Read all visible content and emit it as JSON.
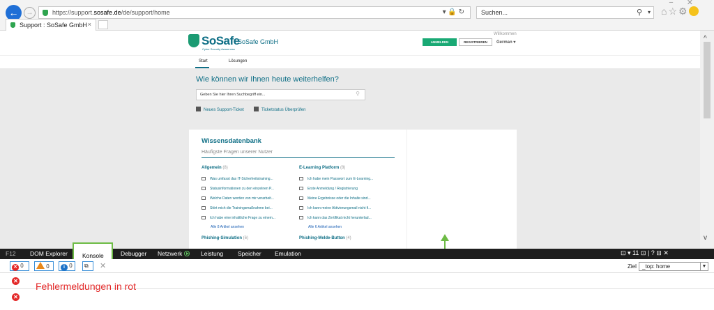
{
  "browser": {
    "url_prefix": "https://support.",
    "url_domain": "sosafe.de",
    "url_path": "/de/support/home",
    "search_placeholder": "Suchen...",
    "tab_title": "Support : SoSafe GmbH",
    "tab_close": "×"
  },
  "site": {
    "logo": "SoSafe",
    "logo_sub": "Cyber Security Awareness",
    "company": "SoSafe GmbH",
    "welcome": "Willkommen",
    "login": "ANMELDEN",
    "register": "REGISTRIEREN",
    "language": "German ▾",
    "nav": {
      "start": "Start",
      "solutions": "Lösungen"
    },
    "hero_title": "Wie können wir Ihnen heute weiterhelfen?",
    "hero_search_placeholder": "Geben Sie hier Ihren Suchbegriff ein...",
    "new_ticket": "Neues Support-Ticket",
    "ticket_status": "Ticketstatus Überprüfen"
  },
  "kb": {
    "title": "Wissensdatenbank",
    "subtitle": "Häufigste Fragen unserer Nutzer",
    "left": {
      "name": "Allgemein",
      "count": "(8)",
      "articles": [
        "Was umfasst das IT-Sicherheitstraining...",
        "Statusinformationen zu den einzelnen P...",
        "Welche Daten werden von mir verarbeit...",
        "Stört mich die Trainingsmaßnahme bei...",
        "Ich habe eine inhaltliche Frage zu einem..."
      ],
      "all": "Alle 8 Artikel ansehen"
    },
    "right": {
      "name": "E-Learning Platform",
      "count": "(8)",
      "articles": [
        "Ich habe mein Passwort zum E-Learning...",
        "Erste Anmeldung / Registrierung",
        "Meine Ergebnisse oder die Inhalte sind...",
        "Ich kann meine Aktivierungsmail nicht fi...",
        "Ich kann das Zertifikat nicht herunterlad..."
      ],
      "all": "Alle 6 Artikel ansehen"
    },
    "next_left": {
      "name": "Phishing-Simulation",
      "count": "(6)"
    },
    "next_right": {
      "name": "Phishing-Melde-Button",
      "count": "(4)"
    }
  },
  "devtools": {
    "f12": "F12",
    "tabs": [
      "DOM Explorer",
      "Konsole",
      "Debugger",
      "Netzwerk",
      "Leistung",
      "Speicher",
      "Emulation"
    ],
    "right_tools": "⊡ ▾ 11    ⊡  |  ?   ⊟   ✕",
    "errors": "0",
    "warnings": "0",
    "infos": "0",
    "target_label": "Ziel",
    "target_value": "_top: home"
  },
  "annotation": "Fehlermeldungen in rot",
  "colors": {
    "brand": "#0f6f86",
    "accent": "#19a974",
    "error": "#e32929",
    "highlight": "#6dbb45"
  }
}
